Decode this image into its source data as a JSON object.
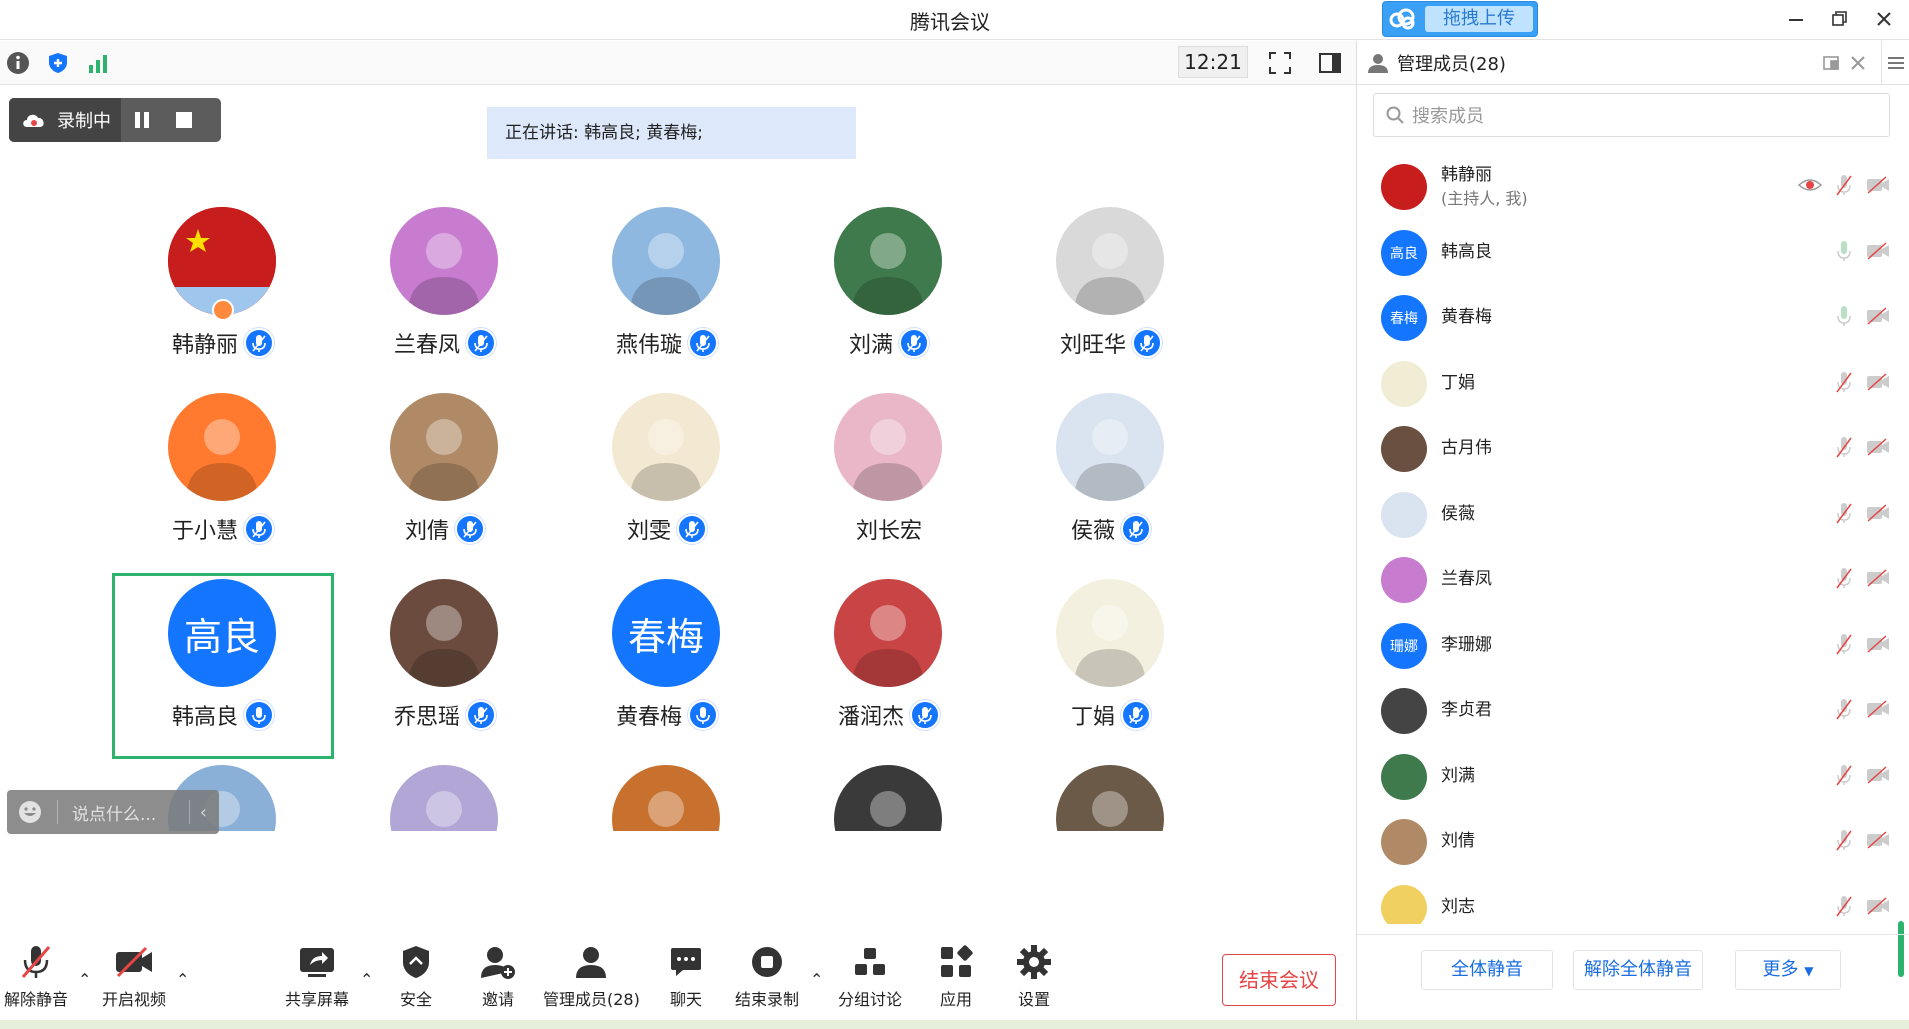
{
  "window": {
    "title": "腾讯会议"
  },
  "upload": {
    "label": "拖拽上传"
  },
  "topbar": {
    "time": "12:21"
  },
  "recording": {
    "label": "录制中"
  },
  "speaking": {
    "text": "正在讲话: 韩高良; 黄春梅;"
  },
  "participants": [
    {
      "name": "韩静丽",
      "avatar": "flag",
      "bg": "#c81d1d",
      "mic": true,
      "host": true
    },
    {
      "name": "兰春凤",
      "avatar": "photo",
      "bg": "#c77cd0",
      "mic": true
    },
    {
      "name": "燕伟璇",
      "avatar": "photo",
      "bg": "#8fb8e0",
      "mic": true
    },
    {
      "name": "刘满",
      "avatar": "photo",
      "bg": "#3f7a4c",
      "mic": true
    },
    {
      "name": "刘旺华",
      "avatar": "photo",
      "bg": "#d9d9d9",
      "mic": true
    },
    {
      "name": "于小慧",
      "avatar": "photo",
      "bg": "#ff7a2e",
      "mic": true
    },
    {
      "name": "刘倩",
      "avatar": "photo",
      "bg": "#b08a66",
      "mic": true
    },
    {
      "name": "刘雯",
      "avatar": "photo",
      "bg": "#f3e9d2",
      "mic": true
    },
    {
      "name": "刘长宏",
      "avatar": "photo",
      "bg": "#e9b7c7",
      "mic": false
    },
    {
      "name": "侯薇",
      "avatar": "photo",
      "bg": "#d9e4f0",
      "mic": true
    },
    {
      "name": "韩高良",
      "avatar": "text",
      "avatar_text": "高良",
      "bg": "#1476ff",
      "mic": true,
      "speaking": true
    },
    {
      "name": "乔思瑶",
      "avatar": "photo",
      "bg": "#6a4b3d",
      "mic": true
    },
    {
      "name": "黄春梅",
      "avatar": "text",
      "avatar_text": "春梅",
      "bg": "#1476ff",
      "mic": true,
      "speaking": true
    },
    {
      "name": "潘润杰",
      "avatar": "photo",
      "bg": "#c94545",
      "mic": true
    },
    {
      "name": "丁娟",
      "avatar": "photo",
      "bg": "#f4f0e0",
      "mic": true
    },
    {
      "name": "",
      "avatar": "photo",
      "bg": "#8ab0d8"
    },
    {
      "name": "",
      "avatar": "photo",
      "bg": "#b2a6d6"
    },
    {
      "name": "",
      "avatar": "photo",
      "bg": "#c8702e"
    },
    {
      "name": "",
      "avatar": "photo",
      "bg": "#3a3a3a"
    },
    {
      "name": "",
      "avatar": "photo",
      "bg": "#6c5a48"
    }
  ],
  "chat": {
    "placeholder": "说点什么..."
  },
  "toolbar": {
    "unmute": "解除静音",
    "video": "开启视频",
    "share": "共享屏幕",
    "security": "安全",
    "invite": "邀请",
    "members": "管理成员(28)",
    "chat": "聊天",
    "stop_record": "结束录制",
    "breakout": "分组讨论",
    "apps": "应用",
    "settings": "设置",
    "end": "结束会议"
  },
  "panel": {
    "title": "管理成员(28)",
    "search_placeholder": "搜索成员",
    "members": [
      {
        "name": "韩静丽",
        "sub": "(主持人, 我)",
        "bg": "#c81d1d",
        "avatar_text": "",
        "mic": "muted"
      },
      {
        "name": "韩高良",
        "sub": "",
        "bg": "#1476ff",
        "avatar_text": "高良",
        "mic": "on"
      },
      {
        "name": "黄春梅",
        "sub": "",
        "bg": "#1476ff",
        "avatar_text": "春梅",
        "mic": "on"
      },
      {
        "name": "丁娟",
        "sub": "",
        "bg": "#f1ecd4",
        "avatar_text": "",
        "mic": "muted"
      },
      {
        "name": "古月伟",
        "sub": "",
        "bg": "#6a5040",
        "avatar_text": "",
        "mic": "muted"
      },
      {
        "name": "侯薇",
        "sub": "",
        "bg": "#d9e4f0",
        "avatar_text": "",
        "mic": "muted"
      },
      {
        "name": "兰春凤",
        "sub": "",
        "bg": "#c77cd0",
        "avatar_text": "",
        "mic": "muted"
      },
      {
        "name": "李珊娜",
        "sub": "",
        "bg": "#1476ff",
        "avatar_text": "珊娜",
        "mic": "muted"
      },
      {
        "name": "李贞君",
        "sub": "",
        "bg": "#444444",
        "avatar_text": "",
        "mic": "muted"
      },
      {
        "name": "刘满",
        "sub": "",
        "bg": "#3f7a4c",
        "avatar_text": "",
        "mic": "muted"
      },
      {
        "name": "刘倩",
        "sub": "",
        "bg": "#b08a66",
        "avatar_text": "",
        "mic": "muted"
      },
      {
        "name": "刘志",
        "sub": "",
        "bg": "#f0d060",
        "avatar_text": "",
        "mic": "muted"
      }
    ],
    "footer": {
      "mute_all": "全体静音",
      "unmute_all": "解除全体静音",
      "more": "更多"
    }
  },
  "colors": {
    "accent": "#1476ff",
    "danger": "#e54545",
    "selected": "#2db36e"
  }
}
